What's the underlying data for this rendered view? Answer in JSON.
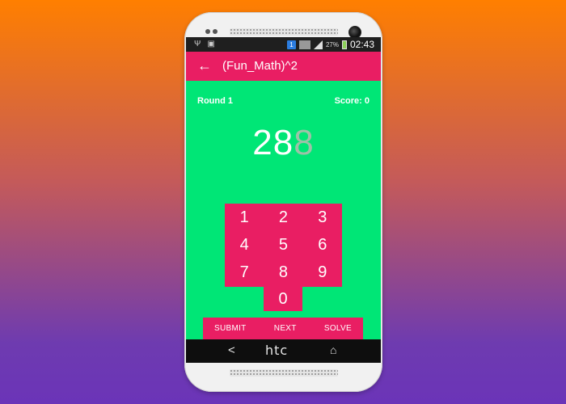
{
  "status_bar": {
    "battery_percent": "27%",
    "notification_badge": "1",
    "time": "02:43",
    "icons": [
      "usb-icon",
      "image-icon",
      "notification-badge",
      "gallery-icon",
      "signal-icon",
      "battery-icon"
    ]
  },
  "app_bar": {
    "back_glyph": "←",
    "title": "(Fun_Math)^2"
  },
  "game": {
    "round_label": "Round 1",
    "score_label": "Score: 0",
    "number_main": "28",
    "number_faded": "8"
  },
  "keypad": {
    "keys": [
      "1",
      "2",
      "3",
      "4",
      "5",
      "6",
      "7",
      "8",
      "9"
    ],
    "zero": "0"
  },
  "actions": {
    "submit": "SUBMIT",
    "next": "NEXT",
    "solve": "SOLVE"
  },
  "nav_bar": {
    "back_glyph": "<",
    "brand": "htc",
    "home_glyph": "⌂"
  },
  "colors": {
    "background_top": "#ff7f00",
    "background_bottom": "#6b34b8",
    "screen": "#00e676",
    "accent": "#e91e63"
  }
}
